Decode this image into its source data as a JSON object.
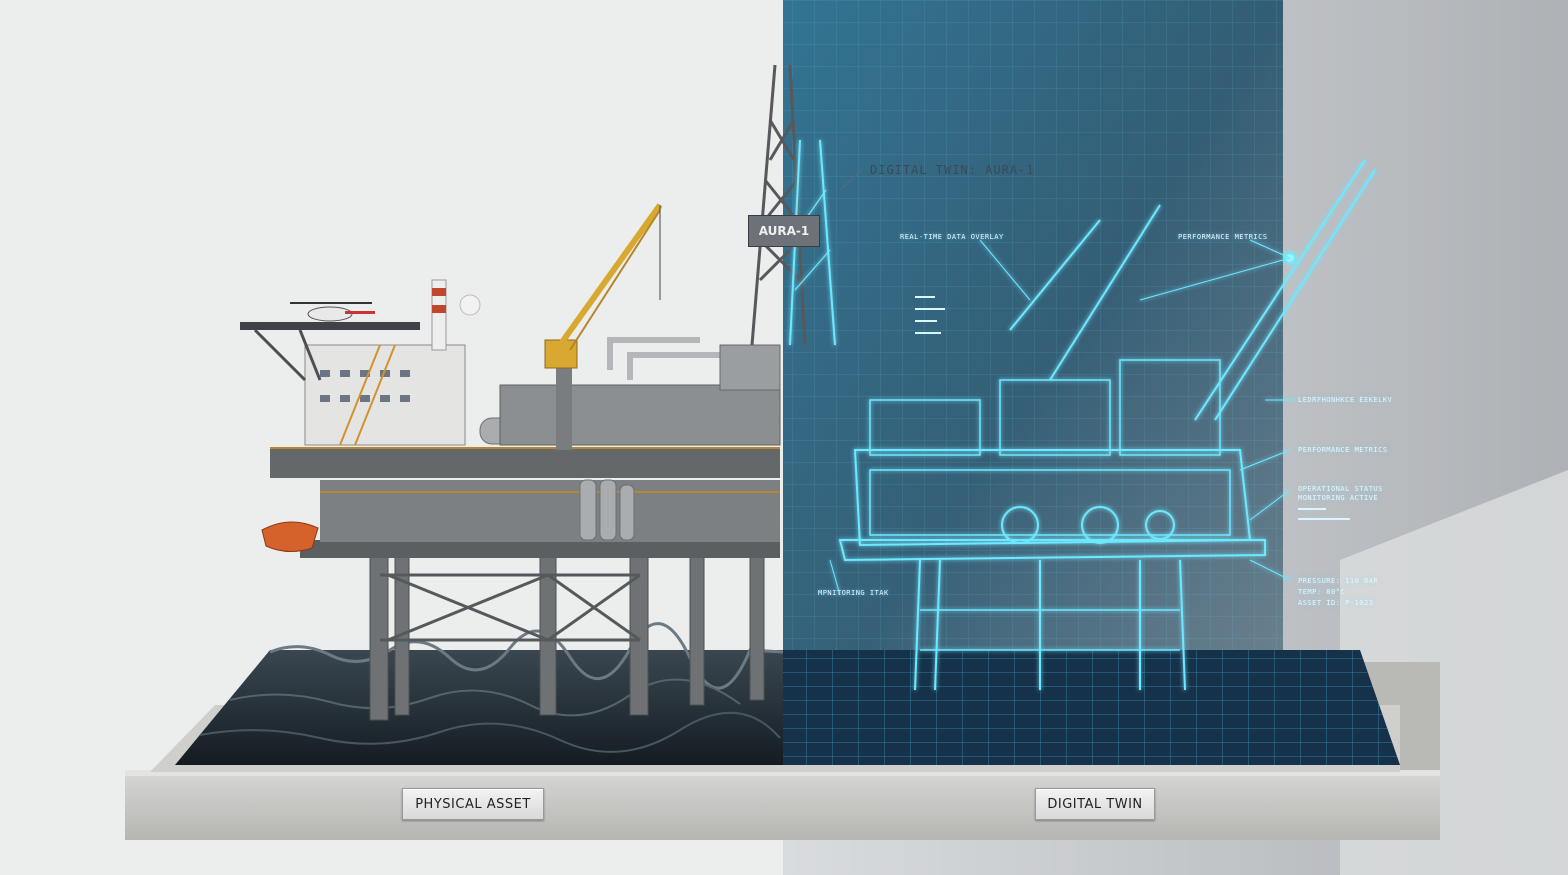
{
  "labels": {
    "digital_twin_title": "DIGITAL TWIN: AURA-1",
    "rig_sign": "AURA-1",
    "realtime_overlay": "REAL-TIME DATA OVERLAY",
    "performance_metrics_top": "PERFORMANCE METRICS",
    "garbled_label": "LEDRFHONHKCE EEKELKV",
    "performance_metrics_mid": "PERFORMANCE METRICS",
    "operational_status_1": "OPERATIONAL STATUS",
    "operational_status_2": "MONITORING ACTIVE",
    "pressure": "PRESSURE: 110 BAR",
    "temp": "TEMP: 80°C",
    "asset_id": "ASSET ID: P-1023",
    "monitoring_left": "MPNITORING ITAK"
  },
  "plaques": {
    "physical": "PHYSICAL ASSET",
    "digital": "DIGITAL TWIN"
  },
  "colors": {
    "background": "#e9eaec",
    "hologram": "#5fe3ff",
    "blueprint_panel": "#1d4a63",
    "ocean": "#1e2a33",
    "concrete": "#c9c9c7"
  }
}
